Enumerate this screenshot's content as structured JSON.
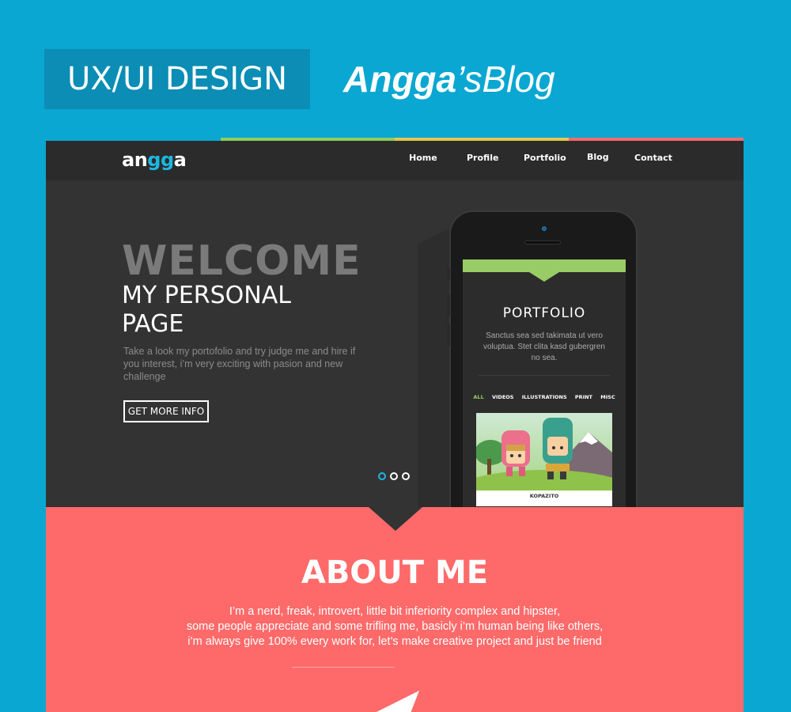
{
  "header": {
    "badge": "UX/UI DESIGN",
    "blog_part1": "Angga",
    "blog_part2": "’sBlog"
  },
  "colors": {
    "background": "#0aa7d2",
    "badge": "#0b8db5",
    "dark": "#333333",
    "accent_blue": "#1cb7e2",
    "accent_green": "#99cc66",
    "about_bg": "#fe6a6a",
    "stripe": [
      "#0aa7d2",
      "#8ccf5c",
      "#e3c64d",
      "#f26b6b"
    ]
  },
  "site": {
    "logo": {
      "prefix": "an",
      "middle": "gg",
      "suffix": "a"
    },
    "nav": [
      "Home",
      "Profile",
      "Portfolio",
      "Blog",
      "Contact"
    ],
    "hero": {
      "welcome": "WELCOME",
      "subtitle_line1": "MY PERSONAL",
      "subtitle_line2": "PAGE",
      "description": "Take a look my portofolio and try judge me and hire if you interest, i’m very exciting with pasion and new challenge",
      "cta": "GET MORE INFO",
      "slides": 3,
      "active_slide": 0
    },
    "phone": {
      "title": "PORTFOLIO",
      "description": "Sanctus sea sed takimata ut vero voluptua. Stet clita kasd gubergren no sea.",
      "filters": [
        "ALL",
        "VIDEOS",
        "ILLUSTRATIONS",
        "PRINT",
        "MISC"
      ],
      "active_filter": "ALL",
      "card_label": "KOPAZITO"
    },
    "about": {
      "title": "ABOUT ME",
      "lines": [
        "I’m a nerd, freak, introvert, little bit inferiority complex and hipster,",
        "some people appreciate and some trifling me, basicly i’m human being like others,",
        "i’m always give 100% every work for, let’s make creative project and just be friend"
      ]
    }
  }
}
